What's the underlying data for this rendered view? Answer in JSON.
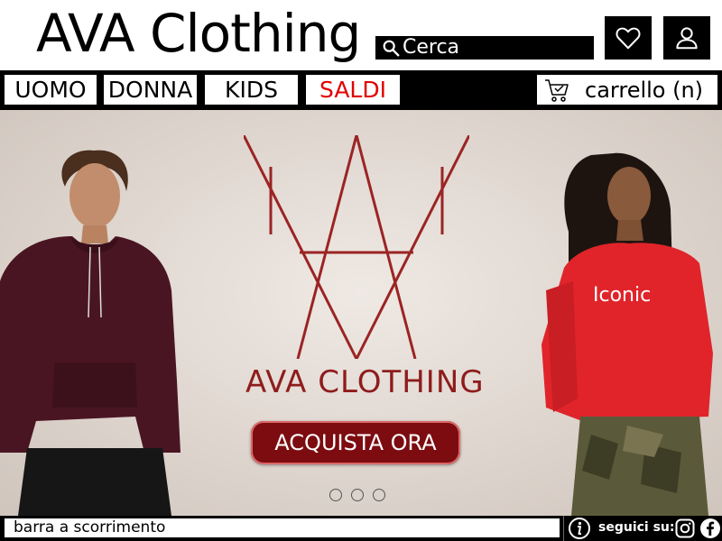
{
  "brand": {
    "title": "AVA Clothing"
  },
  "search": {
    "placeholder": "Cerca"
  },
  "icons": {
    "favorites": "heart-icon",
    "account": "user-icon",
    "search": "search-icon",
    "cart": "cart-icon",
    "info": "info-icon",
    "instagram": "instagram-icon",
    "facebook": "facebook-icon"
  },
  "nav": {
    "items": [
      {
        "label": "UOMO"
      },
      {
        "label": "DONNA"
      },
      {
        "label": "KIDS"
      },
      {
        "label": "SALDI"
      }
    ],
    "cart_label": "carrello (n)"
  },
  "hero": {
    "logo_text": "AVA CLOTHING",
    "cta_label": "ACQUISTA ORA",
    "carousel_slides": 3
  },
  "footer": {
    "scroll_bar_text": "barra a scorrimento",
    "follow_label": "seguici su:"
  },
  "colors": {
    "accent": "#e10000",
    "logo": "#8e1c1c",
    "cta_bg": "#7c0c10",
    "bar": "#000000"
  }
}
